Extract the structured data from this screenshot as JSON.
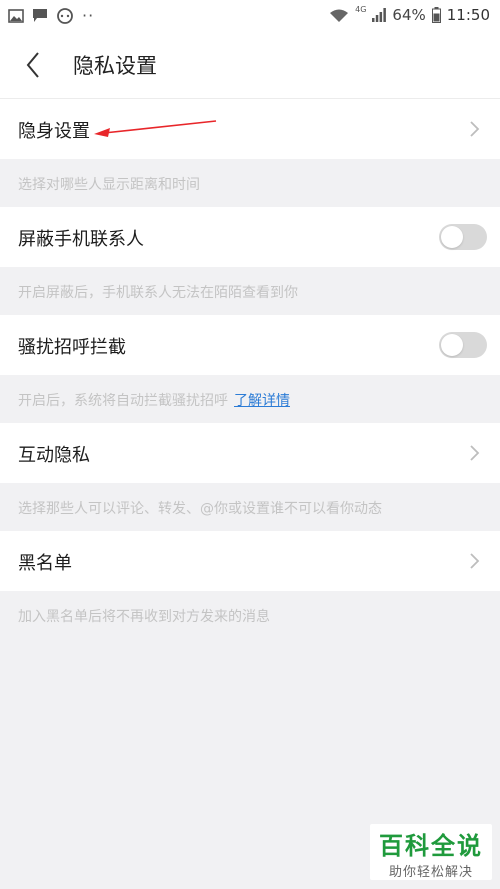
{
  "status_bar": {
    "left_icons": [
      "image-icon",
      "message-icon",
      "chat-icon",
      "dots-icon"
    ],
    "network": "4G",
    "battery": "64%",
    "time": "11:50"
  },
  "header": {
    "title": "隐私设置"
  },
  "rows": [
    {
      "label": "隐身设置",
      "control": "chevron",
      "note": "选择对哪些人显示距离和时间"
    },
    {
      "label": "屏蔽手机联系人",
      "control": "toggle",
      "on": false,
      "note": "开启屏蔽后，手机联系人无法在陌陌查看到你"
    },
    {
      "label": "骚扰招呼拦截",
      "control": "toggle",
      "on": false,
      "note": "开启后，系统将自动拦截骚扰招呼",
      "note_link": "了解详情"
    },
    {
      "label": "互动隐私",
      "control": "chevron",
      "note": "选择那些人可以评论、转发、@你或设置谁不可以看你动态"
    },
    {
      "label": "黑名单",
      "control": "chevron",
      "note": "加入黑名单后将不再收到对方发来的消息"
    }
  ],
  "colors": {
    "accent_link": "#2c7cd6",
    "annotation_arrow": "#e8262a",
    "toggle_off": "#d9d9d9",
    "watermark_green": "#1f9a3c"
  },
  "watermark": {
    "main": "百科全说",
    "sub": "助你轻松解决"
  }
}
